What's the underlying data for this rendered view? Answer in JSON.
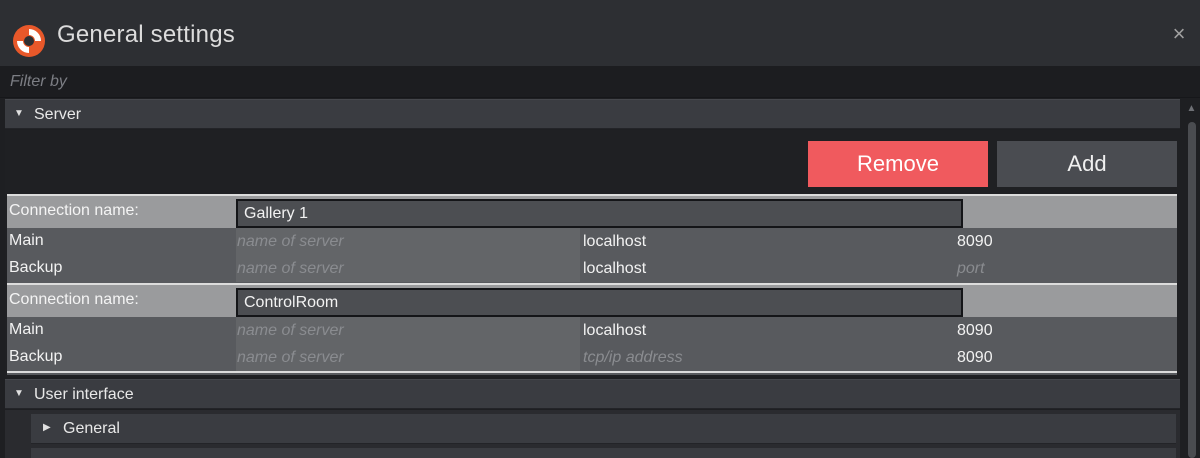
{
  "window": {
    "title": "General settings",
    "close_glyph": "×",
    "logo_icon": "app-logo-icon"
  },
  "filter": {
    "placeholder": "Filter by",
    "value": ""
  },
  "sections": {
    "server": {
      "label": "Server",
      "expanded": true
    },
    "user_interface": {
      "label": "User interface",
      "expanded": true
    }
  },
  "server": {
    "remove_label": "Remove",
    "add_label": "Add",
    "connections": [
      {
        "name_label": "Connection name:",
        "name": "Gallery 1",
        "rows": [
          {
            "label": "Main",
            "server_name": "",
            "server_name_placeholder": "name of server",
            "address": "localhost",
            "address_placeholder": "tcp/ip address",
            "port": "8090",
            "port_placeholder": "port"
          },
          {
            "label": "Backup",
            "server_name": "",
            "server_name_placeholder": "name of server",
            "address": "localhost",
            "address_placeholder": "tcp/ip address",
            "port": "",
            "port_placeholder": "port"
          }
        ]
      },
      {
        "name_label": "Connection name:",
        "name": "ControlRoom",
        "rows": [
          {
            "label": "Main",
            "server_name": "",
            "server_name_placeholder": "name of server",
            "address": "localhost",
            "address_placeholder": "tcp/ip address",
            "port": "8090",
            "port_placeholder": "port"
          },
          {
            "label": "Backup",
            "server_name": "",
            "server_name_placeholder": "name of server",
            "address": "",
            "address_placeholder": "tcp/ip address",
            "port": "8090",
            "port_placeholder": "port"
          }
        ]
      }
    ]
  },
  "user_interface": {
    "subsections": [
      {
        "label": "General",
        "expanded": false
      }
    ]
  },
  "colors": {
    "accent_remove": "#f05a5e",
    "button_add": "#4a4c51",
    "logo_orange": "#e8582a"
  }
}
